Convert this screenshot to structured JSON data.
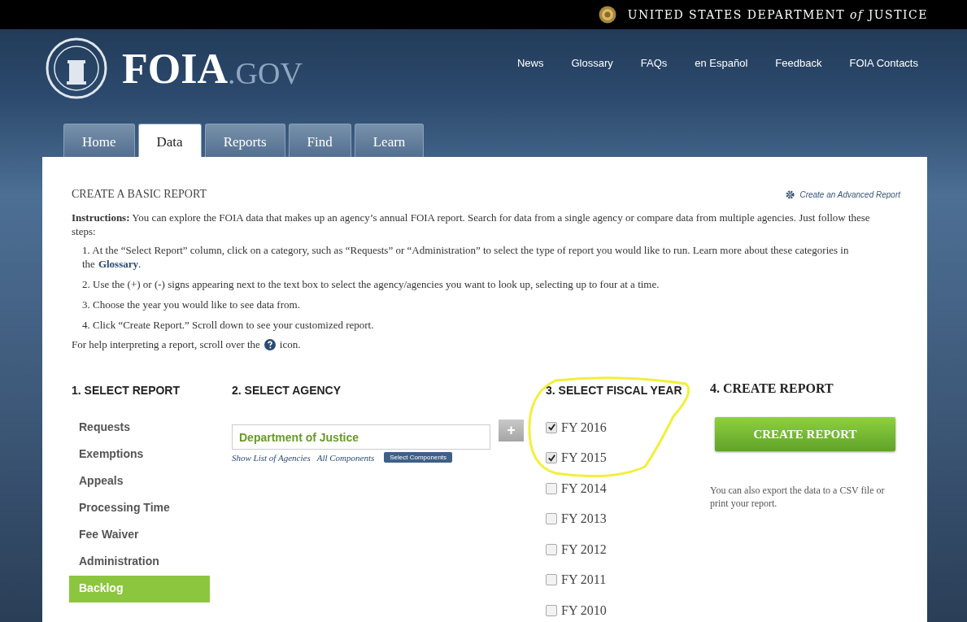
{
  "top_bar": {
    "agency": "UNITED STATES DEPARTMENT *of* JUSTICE"
  },
  "logo": {
    "name": "FOIA",
    "suffix": ".GOV"
  },
  "nav_links": [
    "News",
    "Glossary",
    "FAQs",
    "en Español",
    "Feedback",
    "FOIA Contacts"
  ],
  "tabs": [
    {
      "label": "Home",
      "selected": false
    },
    {
      "label": "Data",
      "selected": true
    },
    {
      "label": "Reports",
      "selected": false
    },
    {
      "label": "Find",
      "selected": false
    },
    {
      "label": "Learn",
      "selected": false
    }
  ],
  "content": {
    "title": "CREATE A BASIC REPORT",
    "advanced_link": "Create an Advanced Report",
    "instructions": "**Instructions:** You can explore the FOIA data that makes up an agency’s annual FOIA report. Search for data from a single agency or compare data from multiple agencies. Just follow these steps:",
    "steps": [
      {
        "text": "1. At the “Select Report” column, click on a category, such as “Requests” or “Administration”  to select the type of report you would like to run. Learn more about these categories in the",
        "link": "Glossary",
        "after": "."
      },
      {
        "text": "2. Use the (+) or (-) signs appearing next to the text box to select the agency/agencies you want to look up, selecting up to four at a time."
      },
      {
        "text": "3. Choose the year you would like to see data from."
      },
      {
        "text": "4. Click “Create Report.”  Scroll down to see your customized report."
      }
    ],
    "help_before": "For help interpreting a report, scroll over the",
    "help_after": "icon.",
    "report": {
      "heading": "1. SELECT REPORT",
      "items": [
        {
          "label": "Requests",
          "selected": false
        },
        {
          "label": "Exemptions",
          "selected": false
        },
        {
          "label": "Appeals",
          "selected": false
        },
        {
          "label": "Processing Time",
          "selected": false
        },
        {
          "label": "Fee Waiver",
          "selected": false
        },
        {
          "label": "Administration",
          "selected": false
        },
        {
          "label": "Backlog",
          "selected": true
        }
      ]
    },
    "agency": {
      "heading": "2. SELECT AGENCY",
      "value": "Department of Justice",
      "add_button": "+",
      "links": [
        "Show List of Agencies",
        "All Components"
      ],
      "components_button": "Select Components"
    },
    "fiscal_year": {
      "heading": "3. SELECT FISCAL YEAR",
      "years": [
        {
          "label": "FY 2016",
          "checked": true
        },
        {
          "label": "FY 2015",
          "checked": true
        },
        {
          "label": "FY 2014",
          "checked": false
        },
        {
          "label": "FY 2013",
          "checked": false
        },
        {
          "label": "FY 2012",
          "checked": false
        },
        {
          "label": "FY 2011",
          "checked": false
        },
        {
          "label": "FY 2010",
          "checked": false
        }
      ]
    },
    "create": {
      "heading": "4. CREATE REPORT",
      "button": "CREATE REPORT",
      "note": "You can also export the data to a CSV file or print your report."
    }
  }
}
